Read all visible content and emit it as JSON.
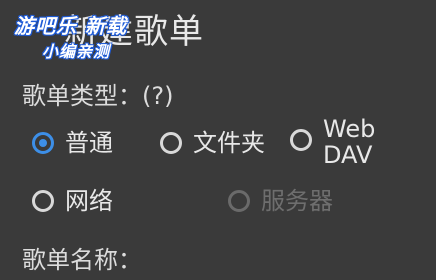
{
  "dialog": {
    "title": "新建歌单"
  },
  "watermark": {
    "line1": "游吧乐 新载",
    "line2": "小编亲测"
  },
  "playlist_type": {
    "label": "歌单类型：(?)",
    "options": [
      {
        "label": "普通",
        "selected": true,
        "enabled": true
      },
      {
        "label": "文件夹",
        "selected": false,
        "enabled": true
      },
      {
        "label": "WebDAV",
        "selected": false,
        "enabled": true
      },
      {
        "label": "网络",
        "selected": false,
        "enabled": true
      },
      {
        "label": "服务器",
        "selected": false,
        "enabled": false
      }
    ]
  },
  "playlist_name": {
    "label": "歌单名称："
  },
  "colors": {
    "background": "#3a3a3a",
    "accent": "#3d8fe8",
    "disabled": "#6e6e6e"
  }
}
